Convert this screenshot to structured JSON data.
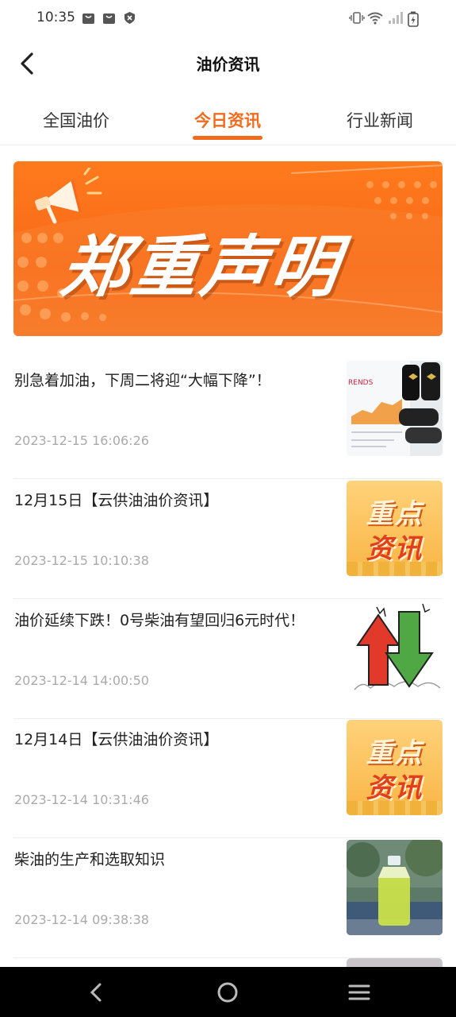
{
  "status_bar": {
    "time": "10:35",
    "left_icons": [
      "bag-icon",
      "bag-icon",
      "shield-icon"
    ],
    "right_icons": [
      "vibrate-icon",
      "wifi-icon",
      "signal-icon",
      "battery-charging-icon"
    ]
  },
  "header": {
    "title": "油价资讯",
    "back_icon": "back-arrow-icon"
  },
  "tabs": [
    {
      "label": "全国油价",
      "active": false
    },
    {
      "label": "今日资讯",
      "active": true
    },
    {
      "label": "行业新闻",
      "active": false
    }
  ],
  "banner": {
    "text": "郑重声明",
    "icon": "megaphone-icon",
    "color": "#f7691a"
  },
  "news": [
    {
      "title": "别急着加油，下周二将迎“大幅下降”！",
      "date": "2023-12-15 16:06:26",
      "thumb": "oil-trends-chart-image"
    },
    {
      "title": "12月15日【云供油油价资讯】",
      "date": "2023-12-15 10:10:38",
      "thumb": "key-news-image",
      "thumb_text": [
        "重点",
        "资讯"
      ]
    },
    {
      "title": "油价延续下跌！0号柴油有望回归6元时代！",
      "date": "2023-12-14 14:00:50",
      "thumb": "up-down-arrows-image"
    },
    {
      "title": "12月14日【云供油油价资讯】",
      "date": "2023-12-14 10:31:46",
      "thumb": "key-news-image",
      "thumb_text": [
        "重点",
        "资讯"
      ]
    },
    {
      "title": "柴油的生产和选取知识",
      "date": "2023-12-14 09:38:38",
      "thumb": "diesel-bottle-image"
    }
  ],
  "nav_bar": {
    "buttons": [
      "back-triangle-icon",
      "home-circle-icon",
      "menu-lines-icon"
    ]
  },
  "colors": {
    "accent": "#f26b1d",
    "date_gray": "#aaaaaa"
  }
}
